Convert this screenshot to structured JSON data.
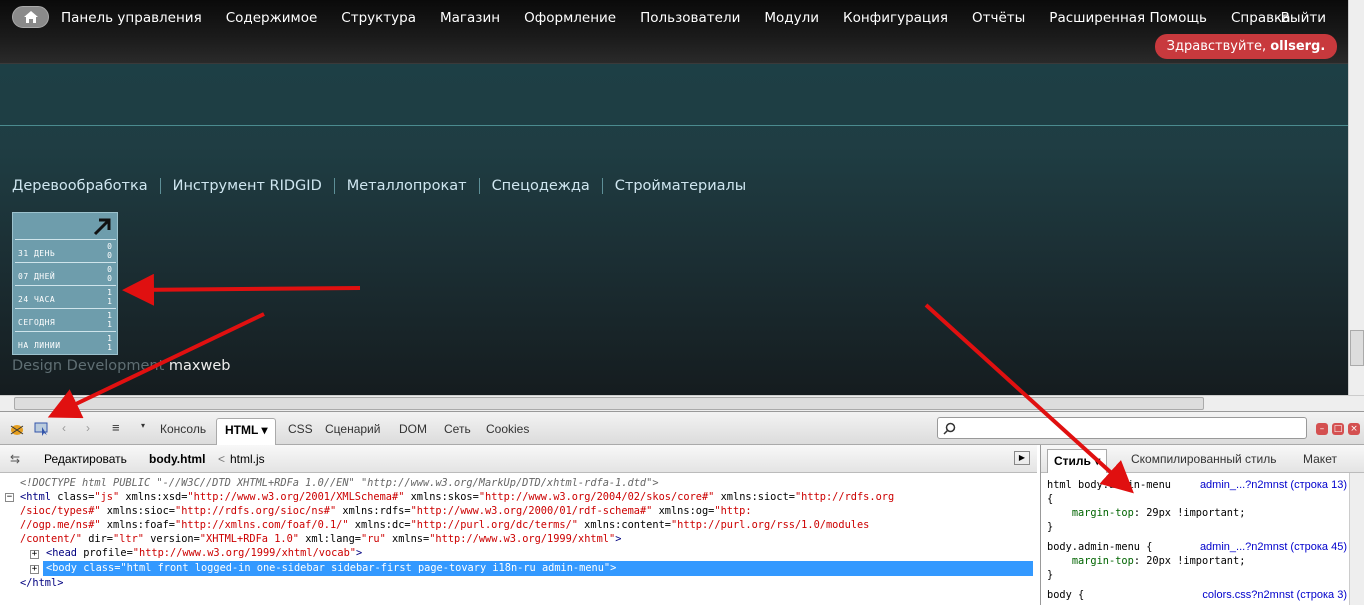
{
  "admin_menu": {
    "items": [
      "Панель управления",
      "Содержимое",
      "Структура",
      "Магазин",
      "Оформление",
      "Пользователи",
      "Модули",
      "Конфигурация",
      "Отчёты",
      "Расширенная Помощь",
      "Справка"
    ],
    "logout": "Выйти",
    "greeting": "Здравствуйте,",
    "username": "ollserg."
  },
  "site": {
    "categories": [
      "Деревообработка",
      "Инструмент RIDGID",
      "Металлопрокат",
      "Спецодежда",
      "Стройматериалы"
    ],
    "counter": [
      {
        "label": "31 ДЕНЬ",
        "value": "0\n0"
      },
      {
        "label": "07 ДНЕЙ",
        "value": "0\n0"
      },
      {
        "label": "24 ЧАСА",
        "value": "1\n1"
      },
      {
        "label": "СЕГОДНЯ",
        "value": "1\n1"
      },
      {
        "label": "НА ЛИНИИ",
        "value": "1\n1"
      }
    ],
    "credit_prefix": "Design Development",
    "credit_name": "maxweb"
  },
  "firebug": {
    "tabs": [
      "Консоль",
      "HTML",
      "CSS",
      "Сценарий",
      "DOM",
      "Сеть",
      "Cookies"
    ],
    "selected_tab": "HTML",
    "edit_label": "Редактировать",
    "breadcrumb_current": "body.html",
    "breadcrumb_sep": "<",
    "breadcrumb_parent": "html.js",
    "side_tabs": [
      "Стиль",
      "Скомпилированный стиль",
      "Макет"
    ],
    "selected_side_tab": "Стиль"
  },
  "colors": {
    "accent": "#c8393d",
    "selection": "#3399ff",
    "site_bg": "#1d3f45"
  }
}
